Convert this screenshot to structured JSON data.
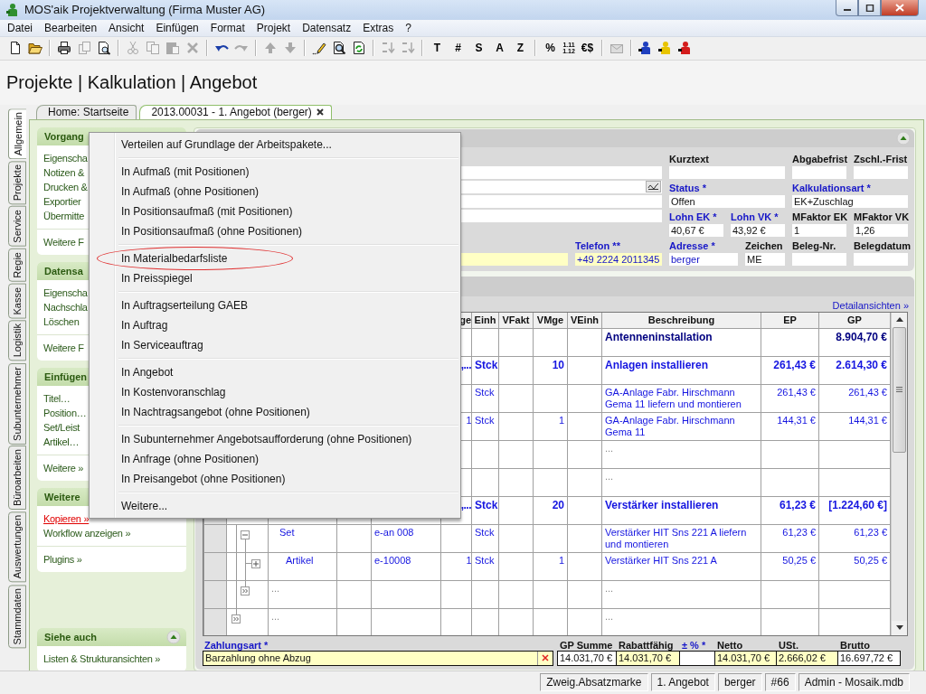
{
  "window": {
    "title": "MOS'aik Projektverwaltung (Firma Muster AG)"
  },
  "menu": [
    "Datei",
    "Bearbeiten",
    "Ansicht",
    "Einfügen",
    "Format",
    "Projekt",
    "Datensatz",
    "Extras",
    "?"
  ],
  "toolbar": [
    [
      {
        "disabled": false
      },
      {
        "disabled": false
      }
    ],
    [
      {
        "disabled": false
      },
      {
        "disabled": true
      },
      {
        "disabled": false
      }
    ],
    [
      {
        "disabled": true
      },
      {
        "disabled": true
      },
      {
        "disabled": true
      },
      {
        "disabled": true
      }
    ],
    [
      {
        "disabled": false
      },
      {
        "disabled": true
      }
    ],
    [
      {
        "disabled": true
      },
      {
        "disabled": true
      }
    ],
    [
      {
        "disabled": false
      },
      {
        "disabled": false
      },
      {
        "disabled": false
      }
    ],
    [
      {
        "disabled": true
      },
      {
        "disabled": true
      }
    ],
    [
      {
        "label": "T",
        "disabled": false
      },
      {
        "label": "#",
        "disabled": false
      },
      {
        "label": "S",
        "disabled": false
      },
      {
        "label": "A",
        "disabled": false
      },
      {
        "label": "Z",
        "disabled": false
      }
    ],
    [
      {
        "label": "%",
        "disabled": false
      },
      {
        "label": "1.11 1.12",
        "disabled": false
      },
      {
        "label": "€$",
        "disabled": false
      }
    ],
    [
      {
        "disabled": true
      }
    ],
    [
      {
        "disabled": false
      },
      {
        "disabled": false
      },
      {
        "disabled": false
      }
    ]
  ],
  "heading": "Projekte | Kalkulation | Angebot",
  "side_tabs": [
    {
      "label": "Allgemein",
      "selected": true
    },
    {
      "label": "Projekte",
      "selected": false
    },
    {
      "label": "Service",
      "selected": false
    },
    {
      "label": "Regie",
      "selected": false
    },
    {
      "label": "Kasse",
      "selected": false
    },
    {
      "label": "Logistik",
      "selected": false
    },
    {
      "label": "Subunternehmer",
      "selected": false
    },
    {
      "label": "Büroarbeiten",
      "selected": false
    },
    {
      "label": "Auswertungen",
      "selected": false
    },
    {
      "label": "Stammdaten",
      "selected": false
    }
  ],
  "doc_tabs": [
    {
      "label": "Home: Startseite",
      "selected": false,
      "closable": false
    },
    {
      "label": "2013.00031 - 1. Angebot (berger)",
      "selected": true,
      "closable": true
    }
  ],
  "sidebar": [
    {
      "title": "Vorgang",
      "collapsible": false,
      "groups": [
        [
          {
            "label": "Eigenscha",
            "hovered": false
          },
          {
            "label": "Notizen &",
            "hovered": false
          },
          {
            "label": "Drucken &",
            "hovered": false
          },
          {
            "label": "Exportier",
            "hovered": false
          },
          {
            "label": "Übermitte",
            "hovered": false
          }
        ],
        [
          {
            "label": "Weitere F",
            "hovered": false
          }
        ]
      ]
    },
    {
      "title": "Datensa",
      "collapsible": false,
      "groups": [
        [
          {
            "label": "Eigenscha",
            "hovered": false
          },
          {
            "label": "Nachschla",
            "hovered": false
          },
          {
            "label": "Löschen",
            "hovered": false
          }
        ],
        [
          {
            "label": "Weitere F",
            "hovered": false
          }
        ]
      ]
    },
    {
      "title": "Einfügen",
      "collapsible": false,
      "groups": [
        [
          {
            "label": "Titel…",
            "hovered": false
          },
          {
            "label": "Position…",
            "hovered": false
          },
          {
            "label": "Set/Leist",
            "hovered": false
          },
          {
            "label": "Artikel…",
            "hovered": false
          }
        ],
        [
          {
            "label": "Weitere »",
            "hovered": false
          }
        ]
      ]
    },
    {
      "title": "Weitere",
      "collapsible": false,
      "groups": [
        [
          {
            "label": "Kopieren »",
            "hovered": true
          },
          {
            "label": "Workflow anzeigen »",
            "hovered": false
          }
        ],
        [
          {
            "label": "Plugins »",
            "hovered": false
          }
        ]
      ]
    },
    {
      "title": "Siehe auch",
      "collapsible": true,
      "groups": [
        [
          {
            "label": "Listen & Strukturansichten »",
            "hovered": false
          }
        ]
      ]
    }
  ],
  "details": {
    "collapsible": true,
    "left_fields": [
      {
        "kind": "text"
      },
      {
        "kind": "lookup"
      },
      {
        "kind": "text"
      },
      {
        "kind": "text"
      }
    ],
    "fields": [
      {
        "label": "Kurztext"
      },
      {
        "label": "Abgabefrist"
      },
      {
        "label": "Zschl.-Frist"
      },
      {
        "label": "Status *",
        "value": "Offen",
        "required": true
      },
      {
        "label": "Kalkulationsart *",
        "value": "EK+Zuschlag",
        "required": true
      },
      {
        "label": "Lohn EK *",
        "value": "40,67 €",
        "required": true
      },
      {
        "label": "Lohn VK *",
        "value": "43,92 €",
        "required": true
      },
      {
        "label": "MFaktor EK",
        "value": "1"
      },
      {
        "label": "MFaktor VK",
        "value": "1,26"
      },
      {
        "highlighted": true
      },
      {
        "label": "Telefon **",
        "value": "+49 2224 2011345",
        "required": true,
        "highlighted": true,
        "link": true
      },
      {
        "label": "Adresse *",
        "value": "berger",
        "required": true,
        "link": true
      },
      {
        "label": "Zeichen",
        "value": "ME"
      },
      {
        "label": "Beleg-Nr."
      },
      {
        "label": "Belegdatum"
      }
    ]
  },
  "positions": {
    "link": "Detailansichten »",
    "header": {
      "column_6": "ge",
      "einh": "Einh",
      "vfakt": "VFakt",
      "vmge": "VMge",
      "veinh": "VEinh",
      "beschreibung": "Beschreibung",
      "ep": "EP",
      "gp": "GP"
    },
    "rows": [
      {
        "kind": "title",
        "cells": {
          "beschreibung": "Antenneninstallation",
          "gp": "8.904,70 €"
        }
      },
      {
        "kind": "position",
        "cells": {
          "column_6": ",...",
          "einh": "Stck",
          "vmge": "10",
          "beschreibung": "Anlagen installieren",
          "ep": "261,43 €",
          "gp": "2.614,30 €"
        }
      },
      {
        "kind": "set",
        "cells": {
          "einh": "Stck",
          "beschreibung": "GA-Anlage Fabr. Hirschmann Gema 11 liefern und montieren",
          "ep": "261,43 €",
          "gp": "261,43 €"
        }
      },
      {
        "kind": "article",
        "cells": {
          "column_6": "1",
          "einh": "Stck",
          "vmge": "1",
          "beschreibung": "GA-Anlage Fabr. Hirschmann Gema 11",
          "ep": "144,31 €",
          "gp": "144,31 €"
        }
      },
      {
        "kind": "placeholder",
        "cells": {
          "beschreibung": "..."
        }
      },
      {
        "kind": "placeholder",
        "cells": {
          "beschreibung": "..."
        }
      },
      {
        "kind": "position",
        "cells": {
          "column_6": ",...",
          "einh": "Stck",
          "vmge": "20",
          "beschreibung": "Verstärker installieren",
          "ep": "61,23 €",
          "gp": "[1.224,60 €]"
        }
      },
      {
        "kind": "set",
        "tree": {
          "kind": "collapse"
        },
        "cells": {
          "column_3": "Set",
          "column_5": "e-an 008",
          "einh": "Stck",
          "beschreibung": "Verstärker HIT Sns 221 A liefern und montieren",
          "ep": "61,23 €",
          "gp": "61,23 €"
        }
      },
      {
        "kind": "article",
        "tree": {
          "kind": "expand"
        },
        "cells": {
          "column_3": "Artikel",
          "column_5": "e-10008",
          "column_6": "1",
          "einh": "Stck",
          "vmge": "1",
          "beschreibung": "Verstärker HIT Sns 221 A",
          "ep": "50,25 €",
          "gp": "50,25 €"
        }
      },
      {
        "kind": "placeholder",
        "tree": {
          "kind": "more-child"
        },
        "cells": {
          "column_3": "...",
          "beschreibung": "..."
        }
      },
      {
        "kind": "placeholder",
        "tree": {
          "kind": "more"
        },
        "cells": {
          "column_3": "...",
          "beschreibung": "..."
        }
      }
    ]
  },
  "payment": {
    "label": "Zahlungsart *",
    "value": "Barzahlung ohne Abzug",
    "required": true,
    "highlighted": true
  },
  "totals": [
    {
      "label": "GP Summe",
      "value": "14.031,70 €",
      "highlighted": false
    },
    {
      "label": "Rabattfähig",
      "value": "14.031,70 €",
      "highlighted": true
    },
    {
      "label": "± % *",
      "required": true,
      "highlighted": false
    },
    {
      "label": "Netto",
      "value": "14.031,70 €",
      "highlighted": true
    },
    {
      "label": "USt.",
      "value": "2.666,02 €",
      "highlighted": true
    },
    {
      "label": "Brutto",
      "value": "16.697,72 €",
      "highlighted": false
    }
  ],
  "status_bar": [
    "Zweig.Absatzmarke",
    "1. Angebot",
    "berger",
    "#66",
    "Admin - Mosaik.mdb"
  ],
  "context_menu": [
    {
      "items": [
        {
          "label": "Verteilen auf Grundlage der Arbeitspakete...",
          "circled": false
        }
      ]
    },
    {
      "items": [
        {
          "label": "In Aufmaß (mit Positionen)",
          "circled": false
        },
        {
          "label": "In Aufmaß (ohne Positionen)",
          "circled": false
        },
        {
          "label": "In Positionsaufmaß (mit Positionen)",
          "circled": false
        },
        {
          "label": "In Positionsaufmaß (ohne Positionen)",
          "circled": false
        }
      ]
    },
    {
      "items": [
        {
          "label": "In Materialbedarfsliste",
          "circled": true
        },
        {
          "label": "In Preisspiegel",
          "circled": false
        }
      ]
    },
    {
      "items": [
        {
          "label": "In Auftragserteilung GAEB",
          "circled": false
        },
        {
          "label": "In Auftrag",
          "circled": false
        },
        {
          "label": "In Serviceauftrag",
          "circled": false
        }
      ]
    },
    {
      "items": [
        {
          "label": "In Angebot",
          "circled": false
        },
        {
          "label": "In Kostenvoranschlag",
          "circled": false
        },
        {
          "label": "In Nachtragsangebot (ohne Positionen)",
          "circled": false
        }
      ]
    },
    {
      "items": [
        {
          "label": "In Subunternehmer Angebotsaufforderung (ohne Positionen)",
          "circled": false
        },
        {
          "label": "In Anfrage (ohne Positionen)",
          "circled": false
        },
        {
          "label": "In Preisangebot (ohne Positionen)",
          "circled": false
        }
      ]
    },
    {
      "items": [
        {
          "label": "Weitere...",
          "circled": false
        }
      ]
    }
  ]
}
